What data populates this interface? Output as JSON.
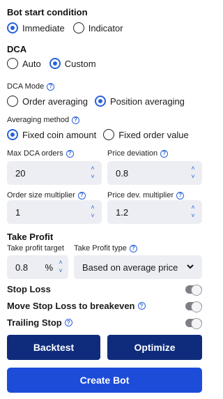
{
  "bot_start": {
    "title": "Bot start condition",
    "options": [
      {
        "label": "Immediate",
        "selected": true
      },
      {
        "label": "Indicator",
        "selected": false
      }
    ]
  },
  "dca": {
    "title": "DCA",
    "options": [
      {
        "label": "Auto",
        "selected": false
      },
      {
        "label": "Custom",
        "selected": true
      }
    ],
    "mode_label": "DCA Mode",
    "mode_options": [
      {
        "label": "Order averaging",
        "selected": false
      },
      {
        "label": "Position averaging",
        "selected": true
      }
    ],
    "method_label": "Averaging method",
    "method_options": [
      {
        "label": "Fixed coin amount",
        "selected": true
      },
      {
        "label": "Fixed order value",
        "selected": false
      }
    ]
  },
  "fields": {
    "max_dca_orders": {
      "label": "Max DCA orders",
      "value": "20"
    },
    "price_deviation": {
      "label": "Price deviation",
      "value": "0.8"
    },
    "order_size_multiplier": {
      "label": "Order size multiplier",
      "value": "1"
    },
    "price_dev_multiplier": {
      "label": "Price dev. multiplier",
      "value": "1.2"
    }
  },
  "take_profit": {
    "title": "Take Profit",
    "target_label": "Take profit target",
    "target_value": "0.8",
    "target_unit": "%",
    "type_label": "Take Profit type",
    "type_value": "Based on average price"
  },
  "toggles": {
    "stop_loss": {
      "label": "Stop Loss",
      "on": false
    },
    "move_sl": {
      "label": "Move Stop Loss to breakeven",
      "on": false
    },
    "trailing_stop": {
      "label": "Trailing Stop",
      "on": false
    }
  },
  "buttons": {
    "backtest": "Backtest",
    "optimize": "Optimize",
    "create_bot": "Create Bot"
  },
  "colors": {
    "accent": "#2962d9",
    "dark_button": "#0f2c7c",
    "primary_button": "#1c4cd8",
    "field_bg": "#eceef3"
  }
}
